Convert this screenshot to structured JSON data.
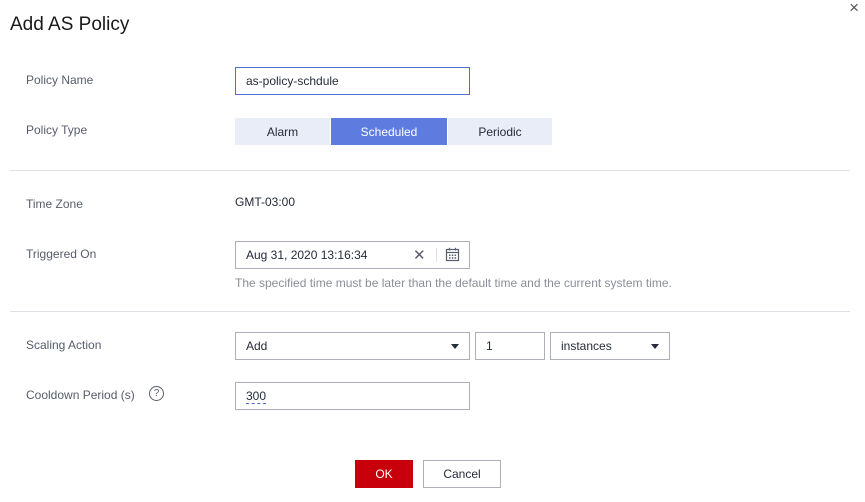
{
  "dialog": {
    "title": "Add AS Policy",
    "close_symbol": "×"
  },
  "policy_name": {
    "label": "Policy Name",
    "value": "as-policy-schdule"
  },
  "policy_type": {
    "label": "Policy Type",
    "options": [
      "Alarm",
      "Scheduled",
      "Periodic"
    ],
    "selected": "Scheduled"
  },
  "time_zone": {
    "label": "Time Zone",
    "value": "GMT-03:00"
  },
  "triggered_on": {
    "label": "Triggered On",
    "value": "Aug 31, 2020 13:16:34",
    "hint": "The specified time must be later than the default time and the current system time."
  },
  "scaling_action": {
    "label": "Scaling Action",
    "action": "Add",
    "count": "1",
    "unit": "instances"
  },
  "cooldown": {
    "label": "Cooldown Period (s)",
    "value": "300",
    "help_symbol": "?"
  },
  "footer": {
    "ok_label": "OK",
    "cancel_label": "Cancel"
  },
  "colors": {
    "primary": "#5e7ce0",
    "danger": "#c7000b",
    "segment_bg": "#e9edf7"
  }
}
